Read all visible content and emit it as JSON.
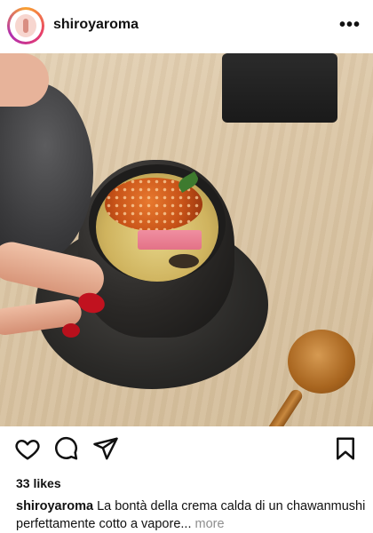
{
  "header": {
    "username": "shiroyaroma",
    "menu_icon": "more-horizontal-icon"
  },
  "post": {
    "image_alt": "chawanmushi photo",
    "likes_text": "33 likes",
    "caption": {
      "username": "shiroyaroma",
      "text": " La bontà della crema calda di un chawanmushi perfettamente cotto a vapore...",
      "more_label": " more"
    }
  },
  "actions": {
    "like_icon": "heart-icon",
    "comment_icon": "comment-icon",
    "share_icon": "send-icon",
    "save_icon": "bookmark-icon"
  },
  "colors": {
    "accent_gradient": [
      "#f9a230",
      "#e73c6c",
      "#b12fb1"
    ],
    "text": "#111111",
    "muted": "#8e8e8e"
  }
}
